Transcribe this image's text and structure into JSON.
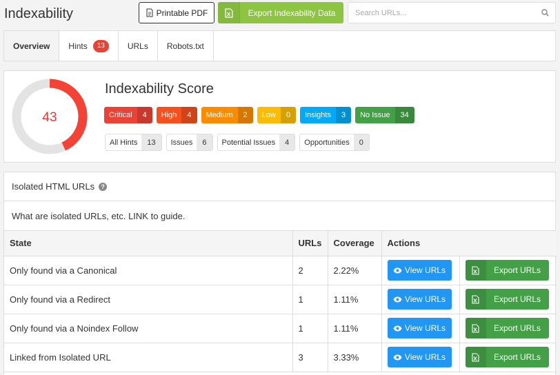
{
  "header": {
    "title": "Indexability",
    "printable_pdf": "Printable PDF",
    "export_label": "Export Indexability Data",
    "search_placeholder": "Search URLs..."
  },
  "tabs": [
    {
      "label": "Overview",
      "active": true
    },
    {
      "label": "Hints",
      "badge": "13"
    },
    {
      "label": "URLs"
    },
    {
      "label": "Robots.txt"
    }
  ],
  "score": {
    "title": "Indexability Score",
    "value": "43",
    "fraction": 0.43,
    "arc_color": "#f44336",
    "track_color": "#e3e3e3"
  },
  "severities": [
    {
      "name": "Critical",
      "count": "4",
      "color": "#ea4335"
    },
    {
      "name": "High",
      "count": "4",
      "color": "#f4511e"
    },
    {
      "name": "Medium",
      "count": "2",
      "color": "#fb8c00"
    },
    {
      "name": "Low",
      "count": "0",
      "color": "#fbbc05"
    },
    {
      "name": "Insights",
      "count": "3",
      "color": "#03a9f4"
    },
    {
      "name": "No Issue",
      "count": "34",
      "color": "#43a047"
    }
  ],
  "hint_counts": [
    {
      "name": "All Hints",
      "count": "13"
    },
    {
      "name": "Issues",
      "count": "6"
    },
    {
      "name": "Potential Issues",
      "count": "4"
    },
    {
      "name": "Opportunities",
      "count": "0"
    }
  ],
  "isolated": {
    "title": "Isolated HTML URLs",
    "description": "What are isolated URLs, etc. LINK to guide.",
    "columns": {
      "state": "State",
      "urls": "URLs",
      "coverage": "Coverage",
      "actions": "Actions"
    },
    "view_label": "View URLs",
    "export_label": "Export URLs",
    "rows": [
      {
        "state": "Only found via a Canonical",
        "urls": "2",
        "coverage": "2.22%"
      },
      {
        "state": "Only found via a Redirect",
        "urls": "1",
        "coverage": "1.11%"
      },
      {
        "state": "Only found via a Noindex Follow",
        "urls": "1",
        "coverage": "1.11%"
      },
      {
        "state": "Linked from Isolated URL",
        "urls": "3",
        "coverage": "3.33%"
      }
    ]
  }
}
